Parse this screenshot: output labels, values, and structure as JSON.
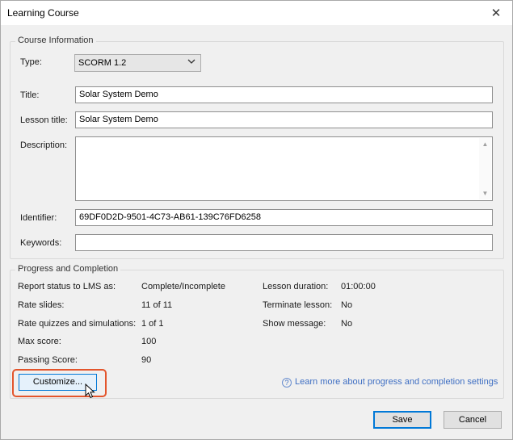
{
  "window": {
    "title": "Learning Course",
    "close_glyph": "✕"
  },
  "course_info": {
    "group_label": "Course Information",
    "type_label": "Type:",
    "type_value": "SCORM 1.2",
    "title_label": "Title:",
    "title_value": "Solar System Demo",
    "lesson_title_label": "Lesson title:",
    "lesson_title_value": "Solar System Demo",
    "description_label": "Description:",
    "description_value": "",
    "identifier_label": "Identifier:",
    "identifier_value": "69DF0D2D-9501-4C73-AB61-139C76FD6258",
    "keywords_label": "Keywords:",
    "keywords_value": ""
  },
  "progress": {
    "group_label": "Progress and Completion",
    "left": [
      {
        "label": "Report status to LMS as:",
        "value": "Complete/Incomplete"
      },
      {
        "label": "Rate slides:",
        "value": "11 of 11"
      },
      {
        "label": "Rate quizzes and simulations:",
        "value": "1 of 1"
      },
      {
        "label": "Max score:",
        "value": "100"
      },
      {
        "label": "Passing Score:",
        "value": "90"
      }
    ],
    "right": [
      {
        "label": "Lesson duration:",
        "value": "01:00:00"
      },
      {
        "label": "Terminate lesson:",
        "value": "No"
      },
      {
        "label": "Show message:",
        "value": "No"
      }
    ],
    "customize_label": "Customize...",
    "help_link": "Learn more about progress and completion settings",
    "help_icon_glyph": "?"
  },
  "footer": {
    "save_label": "Save",
    "cancel_label": "Cancel"
  },
  "icons": {
    "chevron": "chevron-down-icon",
    "close": "close-icon",
    "help": "help-circle-icon",
    "cursor": "mouse-pointer-icon"
  },
  "colors": {
    "accent": "#0078d7",
    "highlight": "#e3552c",
    "link": "#3f6fc3"
  }
}
